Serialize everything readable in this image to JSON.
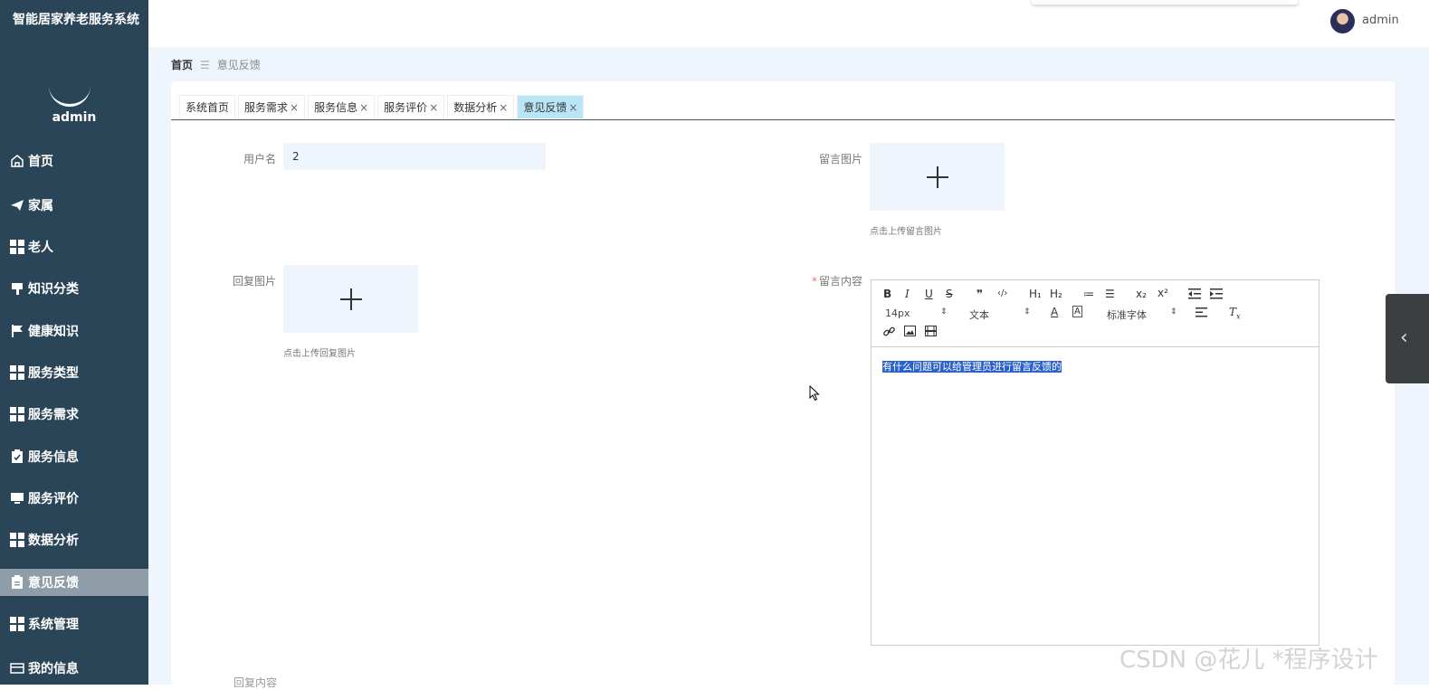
{
  "app": {
    "title": "智能居家养老服务系统"
  },
  "sidebar": {
    "username": "admin",
    "items": [
      {
        "label": "首页",
        "icon": "home-icon"
      },
      {
        "label": "家属",
        "icon": "paper-plane-icon"
      },
      {
        "label": "老人",
        "icon": "grid-icon"
      },
      {
        "label": "知识分类",
        "icon": "brush-icon"
      },
      {
        "label": "健康知识",
        "icon": "flag-icon"
      },
      {
        "label": "服务类型",
        "icon": "grid-icon"
      },
      {
        "label": "服务需求",
        "icon": "grid-icon"
      },
      {
        "label": "服务信息",
        "icon": "clipboard-check-icon"
      },
      {
        "label": "服务评价",
        "icon": "monitor-icon"
      },
      {
        "label": "数据分析",
        "icon": "grid-icon"
      },
      {
        "label": "意见反馈",
        "icon": "clipboard-icon",
        "active": true
      },
      {
        "label": "系统管理",
        "icon": "grid-icon"
      },
      {
        "label": "我的信息",
        "icon": "id-card-icon"
      }
    ]
  },
  "header": {
    "username": "admin"
  },
  "breadcrumb": {
    "home": "首页",
    "separator": "☰",
    "current": "意见反馈"
  },
  "tabs": [
    {
      "label": "系统首页",
      "closable": false
    },
    {
      "label": "服务需求",
      "closable": true
    },
    {
      "label": "服务信息",
      "closable": true
    },
    {
      "label": "服务评价",
      "closable": true
    },
    {
      "label": "数据分析",
      "closable": true
    },
    {
      "label": "意见反馈",
      "closable": true,
      "active": true
    }
  ],
  "tab_close": "×",
  "form": {
    "username_label": "用户名",
    "username_value": "2",
    "message_image_label": "留言图片",
    "message_image_hint": "点击上传留言图片",
    "reply_image_label": "回复图片",
    "reply_image_hint": "点击上传回复图片",
    "message_content_label": "留言内容",
    "required_mark": "*",
    "message_content": "有什么问题可以给管理员进行留言反馈的",
    "reply_content_label": "回复内容"
  },
  "editor_toolbar": {
    "font_size": "14px",
    "paragraph": "文本",
    "font_family": "标准字体",
    "buttons": [
      "B",
      "I",
      "U",
      "S",
      "❞",
      "‹/›",
      "H₁",
      "H₂",
      "≔",
      "☰",
      "x₂",
      "x²"
    ]
  },
  "watermark": "CSDN @花儿 *程序设计",
  "colors": {
    "sidebar": "#2a4558",
    "active_tab": "#b9e5f6",
    "content_bg": "#eef5fc",
    "highlight": "#2b62c9"
  }
}
